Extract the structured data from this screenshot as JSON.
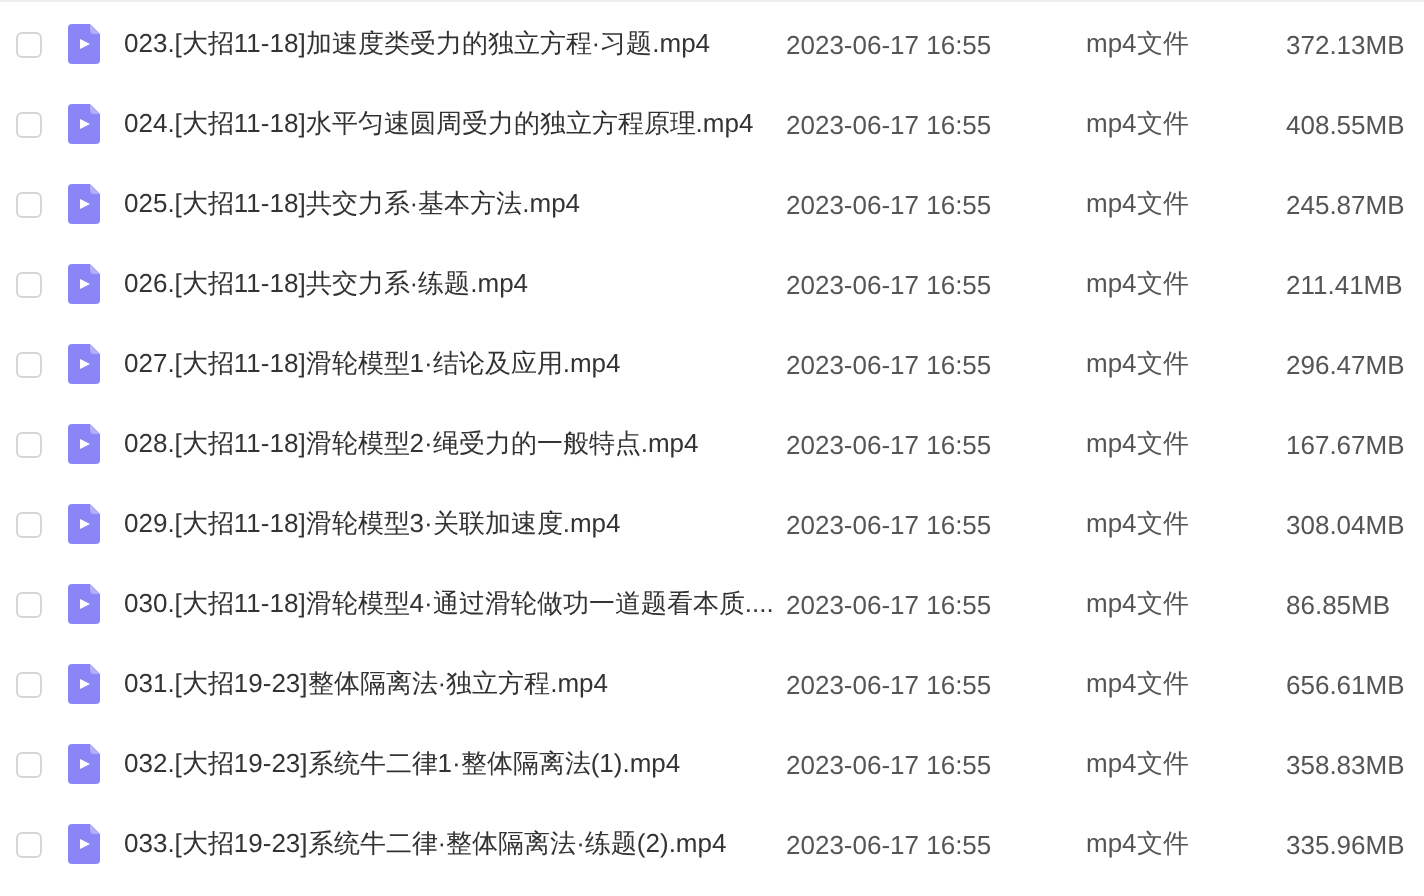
{
  "files": [
    {
      "checked": false,
      "name": "023.[大招11-18]加速度类受力的独立方程·习题.mp4",
      "modified": "2023-06-17 16:55",
      "type": "mp4文件",
      "size": "372.13MB"
    },
    {
      "checked": false,
      "name": "024.[大招11-18]水平匀速圆周受力的独立方程原理.mp4",
      "modified": "2023-06-17 16:55",
      "type": "mp4文件",
      "size": "408.55MB"
    },
    {
      "checked": false,
      "name": "025.[大招11-18]共交力系·基本方法.mp4",
      "modified": "2023-06-17 16:55",
      "type": "mp4文件",
      "size": "245.87MB"
    },
    {
      "checked": false,
      "name": "026.[大招11-18]共交力系·练题.mp4",
      "modified": "2023-06-17 16:55",
      "type": "mp4文件",
      "size": "211.41MB"
    },
    {
      "checked": false,
      "name": "027.[大招11-18]滑轮模型1·结论及应用.mp4",
      "modified": "2023-06-17 16:55",
      "type": "mp4文件",
      "size": "296.47MB"
    },
    {
      "checked": false,
      "name": "028.[大招11-18]滑轮模型2·绳受力的一般特点.mp4",
      "modified": "2023-06-17 16:55",
      "type": "mp4文件",
      "size": "167.67MB"
    },
    {
      "checked": false,
      "name": "029.[大招11-18]滑轮模型3·关联加速度.mp4",
      "modified": "2023-06-17 16:55",
      "type": "mp4文件",
      "size": "308.04MB"
    },
    {
      "checked": false,
      "name": "030.[大招11-18]滑轮模型4·通过滑轮做功一道题看本质....",
      "modified": "2023-06-17 16:55",
      "type": "mp4文件",
      "size": "86.85MB"
    },
    {
      "checked": false,
      "name": "031.[大招19-23]整体隔离法·独立方程.mp4",
      "modified": "2023-06-17 16:55",
      "type": "mp4文件",
      "size": "656.61MB"
    },
    {
      "checked": false,
      "name": "032.[大招19-23]系统牛二律1·整体隔离法(1).mp4",
      "modified": "2023-06-17 16:55",
      "type": "mp4文件",
      "size": "358.83MB"
    },
    {
      "checked": false,
      "name": "033.[大招19-23]系统牛二律·整体隔离法·练题(2).mp4",
      "modified": "2023-06-17 16:55",
      "type": "mp4文件",
      "size": "335.96MB"
    }
  ]
}
